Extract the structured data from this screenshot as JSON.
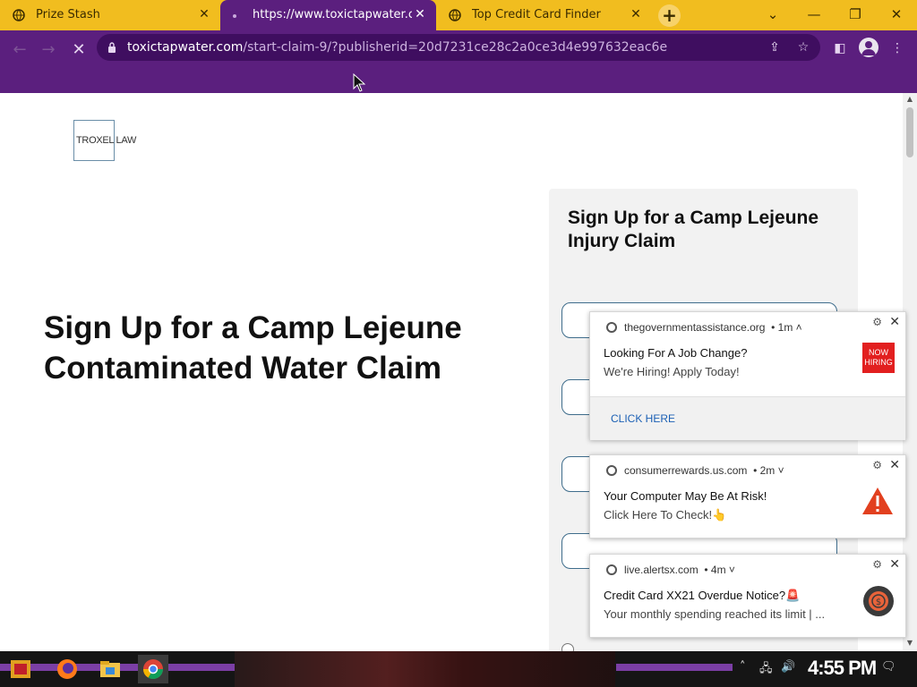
{
  "tabs": [
    {
      "title": "Prize Stash",
      "icon": "globe-icon"
    },
    {
      "title": "https://www.toxictapwater.com",
      "icon": "loading-icon"
    },
    {
      "title": "Top Credit Card Finder",
      "icon": "globe-icon"
    }
  ],
  "address_bar": {
    "host": "toxictapwater.com",
    "path": "/start-claim-9/?publisherid=20d7231ce28c2a0ce3d4e997632eac6e"
  },
  "page": {
    "logo_text": "TROXEL LAW",
    "headline": "Sign Up for a Camp Lejeune Contaminated Water Claim",
    "form_title": "Sign Up for a Camp Lejeune Injury Claim"
  },
  "notifications": [
    {
      "source": "thegovernmentassistance.org",
      "age": "• 1m ˄",
      "title": "Looking For A Job Change?",
      "body": "We're Hiring! Apply Today!",
      "badge": "NOW HIRING",
      "action": "CLICK HERE"
    },
    {
      "source": "consumerrewards.us.com",
      "age": "• 2m ˅",
      "title": " Your Computer May Be At Risk!",
      "body": "Click Here To Check!👆"
    },
    {
      "source": "live.alertsx.com",
      "age": "• 4m ˅",
      "title": "Credit Card XX21 Overdue Notice?🚨",
      "body": " Your monthly spending reached its limit | ..."
    }
  ],
  "taskbar": {
    "clock": "4:55 PM"
  },
  "colors": {
    "tabstrip": "#f1bd1f",
    "toolbar": "#5b1f7e",
    "omnibox": "#3f0e60",
    "form_border": "#3f6d8c",
    "badge_red": "#e21f1f"
  }
}
